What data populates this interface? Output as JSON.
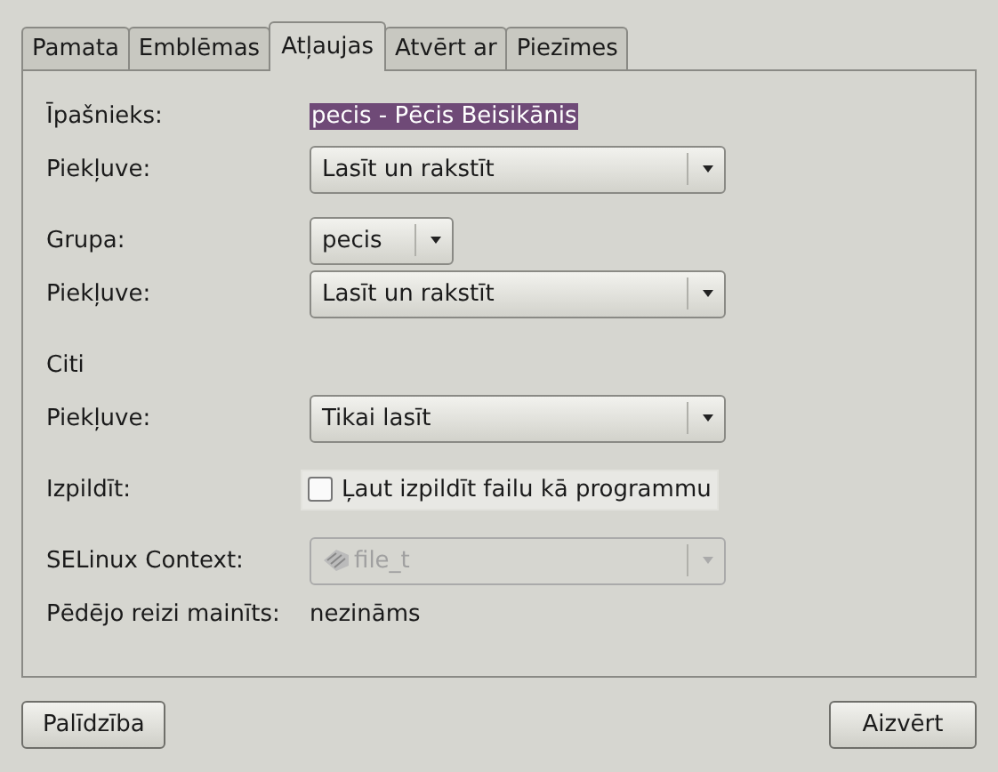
{
  "tabs": [
    {
      "label": "Pamata",
      "selected": false
    },
    {
      "label": "Emblēmas",
      "selected": false
    },
    {
      "label": "Atļaujas",
      "selected": true
    },
    {
      "label": "Atvērt ar",
      "selected": false
    },
    {
      "label": "Piezīmes",
      "selected": false
    }
  ],
  "rows": [
    {
      "kind": "selected-text",
      "label": "Īpašnieks:",
      "value": "pecis - Pēcis Beisikānis"
    },
    {
      "kind": "dropdown",
      "label": "Piekļuve:",
      "value": "Lasīt un rakstīt",
      "disabled": false
    },
    {
      "kind": "spacer"
    },
    {
      "kind": "combo",
      "label": "Grupa:",
      "value": "pecis"
    },
    {
      "kind": "dropdown",
      "label": "Piekļuve:",
      "value": "Lasīt un rakstīt",
      "disabled": false
    },
    {
      "kind": "spacer"
    },
    {
      "kind": "heading",
      "label": "Citi"
    },
    {
      "kind": "dropdown",
      "label": "Piekļuve:",
      "value": "Tikai lasīt",
      "disabled": false
    },
    {
      "kind": "spacer"
    },
    {
      "kind": "checkbox",
      "label": "Izpildīt:",
      "text": "Ļaut izpildīt failu kā programmu",
      "checked": false,
      "hover": true
    },
    {
      "kind": "spacer"
    },
    {
      "kind": "dropdown",
      "label": "SELinux Context:",
      "value": "file_t",
      "disabled": true
    },
    {
      "kind": "text",
      "label": "Pēdējo reizi mainīts:",
      "value": "nezināms"
    }
  ],
  "buttons": [
    {
      "label": "Palīdzība"
    },
    {
      "label": "Aizvērt"
    }
  ]
}
